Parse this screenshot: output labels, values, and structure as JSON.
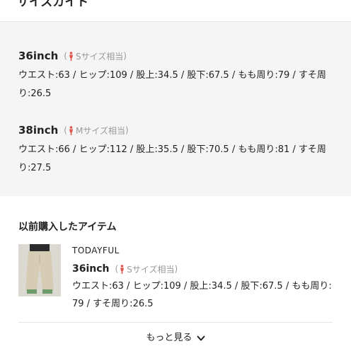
{
  "section_title": "サイズガイド",
  "sizes": [
    {
      "name": "36inch",
      "equiv": "Sサイズ相当",
      "measurements": "ウエスト:63 / ヒップ:109 / 股上:34.5 / 股下:67.5 / もも周り:79 / すそ周り:26.5"
    },
    {
      "name": "38inch",
      "equiv": "Mサイズ相当",
      "measurements": "ウエスト:66 / ヒップ:112 / 股上:35.5 / 股下:70.5 / もも周り:81 / すそ周り:27.5"
    }
  ],
  "history": {
    "title": "以前購入したアイテム",
    "item": {
      "brand": "TODAYFUL",
      "size_name": "36inch",
      "equiv": "Sサイズ相当",
      "measurements": "ウエスト:63 / ヒップ:109 / 股上:34.5 / 股下:67.5 / もも周り:79 / すそ周り:26.5",
      "image": "beige-wide-pants-photo"
    }
  },
  "more_label": "もっと見る",
  "icons": {
    "person": "person-icon",
    "chevron": "chevron-down-icon"
  },
  "colors": {
    "panel_bg": "#f5f5f5",
    "person_icon": "#e0544c",
    "muted_text": "#999999"
  }
}
